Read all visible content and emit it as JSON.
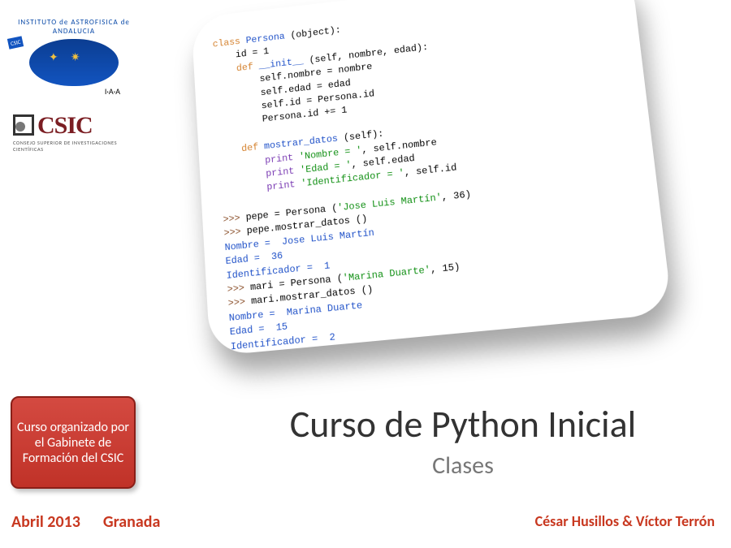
{
  "logos": {
    "iaa_arc_text": "INSTITUTO de ASTROFISICA de ANDALUCIA",
    "iaa_tab": "CSIC",
    "iaa_sub": "I·A·A",
    "csic_wordmark": "CSIC",
    "csic_sub": "CONSEJO SUPERIOR DE INVESTIGACIONES CIENTÍFICAS"
  },
  "code": {
    "l01a": "class",
    "l01b": " Persona ",
    "l01c": "(object):",
    "l02": "    id = 1",
    "l03a": "    def",
    "l03b": " __init__ ",
    "l03c": "(self, nombre, edad):",
    "l04": "        self.nombre = nombre",
    "l05": "        self.edad = edad",
    "l06": "        self.id = Persona.id",
    "l07": "        Persona.id += 1",
    "l08": "",
    "l09a": "    def",
    "l09b": " mostrar_datos ",
    "l09c": "(self):",
    "l10a": "        ",
    "l10p": "print ",
    "l10b": "'Nombre = '",
    "l10c": ", self.nombre",
    "l11a": "        ",
    "l11p": "print ",
    "l11b": "'Edad = '",
    "l11c": ", self.edad",
    "l12a": "        ",
    "l12p": "print ",
    "l12b": "'Identificador = '",
    "l12c": ", self.id",
    "l13": "",
    "l14p": ">>> ",
    "l14": "pepe = Persona (",
    "l14s": "'Jose Luis Martín'",
    "l14e": ", 36)",
    "l15p": ">>> ",
    "l15": "pepe.mostrar_datos ()",
    "l16": "Nombre =  Jose Luis Martín",
    "l17": "Edad =  36",
    "l18": "Identificador =  1",
    "l19p": ">>> ",
    "l19": "mari = Persona (",
    "l19s": "'Marina Duarte'",
    "l19e": ", 15)",
    "l20p": ">>> ",
    "l20": "mari.mostrar_datos ()",
    "l21": "Nombre =  Marina Duarte",
    "l22": "Edad =  15",
    "l23": "Identificador =  2"
  },
  "red_box_text": "Curso organizado por el Gabinete de Formación del CSIC",
  "title": {
    "main": "Curso de Python Inicial",
    "sub": "Clases"
  },
  "footer": {
    "date": "Abril 2013",
    "city": "Granada",
    "authors": "César Husillos & Víctor Terrón"
  }
}
